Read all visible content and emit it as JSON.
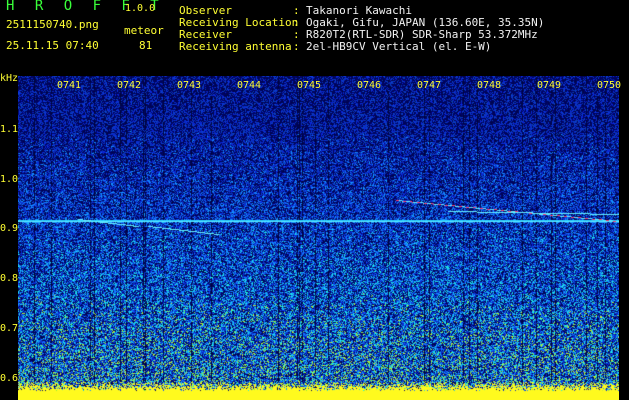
{
  "header": {
    "app_name": "H R O F F T",
    "version": "1.0.0",
    "file_name": "2511150740.png",
    "mode": "meteor",
    "date_time": "25.11.15 07:40",
    "count": "81"
  },
  "station_info": [
    {
      "label": "Observer",
      "value": "Takanori Kawachi"
    },
    {
      "label": "Receiving Location",
      "value": "Ogaki, Gifu, JAPAN (136.60E, 35.35N)"
    },
    {
      "label": "Receiver",
      "value": "R820T2(RTL-SDR) SDR-Sharp 53.372MHz"
    },
    {
      "label": "Receiving antenna",
      "value": "2el-HB9CV Vertical (el. E-W)"
    }
  ],
  "spectrogram": {
    "unit": "kHz",
    "y_labels": [
      "1.1",
      "1.0",
      "0.9",
      "0.8",
      "0.7",
      "0.6"
    ],
    "time_labels": [
      "0741",
      "0742",
      "0743",
      "0744",
      "0745",
      "0746",
      "0747",
      "0748",
      "0749",
      "0750"
    ],
    "colors": {
      "background": "#00065e",
      "noise": "#1a3cff",
      "signal": "#21d6ff",
      "strong": "#ff3366",
      "baseline": "#ffff00"
    }
  }
}
